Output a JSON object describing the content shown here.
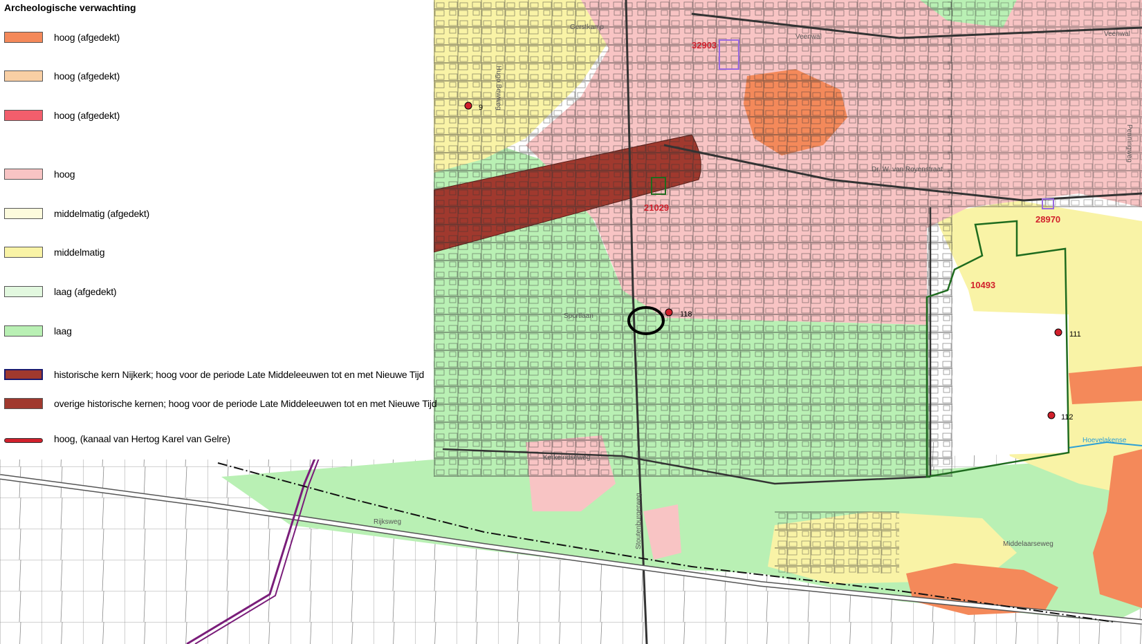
{
  "legend": {
    "title": "Archeologische  verwachting",
    "items": [
      {
        "label": "hoog (afgedekt)",
        "color": "#f4895a",
        "kind": "box"
      },
      {
        "label": "hoog (afgedekt)",
        "color": "#f9cfa4",
        "kind": "box"
      },
      {
        "label": "hoog (afgedekt)",
        "color": "#f25e6c",
        "kind": "box"
      },
      {
        "label": "hoog",
        "color": "#f8c4c4",
        "kind": "box"
      },
      {
        "label": "middelmatig (afgedekt)",
        "color": "#fdfbdd",
        "kind": "box"
      },
      {
        "label": "middelmatig",
        "color": "#f9f3a6",
        "kind": "box"
      },
      {
        "label": "laag (afgedekt)",
        "color": "#e2f8df",
        "kind": "box"
      },
      {
        "label": "laag",
        "color": "#b9f0b4",
        "kind": "box"
      },
      {
        "label": "historische kern Nijkerk; hoog voor de periode Late Middeleeuwen tot en met Nieuwe Tijd",
        "color": "#a0392e",
        "kind": "box-thick"
      },
      {
        "label": "overige historische kernen; hoog voor de periode Late Middeleeuwen tot en met Nieuwe Tijd",
        "color": "#a0392e",
        "kind": "box"
      },
      {
        "label": "hoog, (kanaal van Hertog Karel van Gelre)",
        "color": "#d1202c",
        "kind": "line"
      }
    ]
  },
  "map": {
    "site_labels": [
      "32903",
      "21029",
      "28970",
      "10493"
    ],
    "point_labels": [
      "9",
      "118",
      "111",
      "112"
    ],
    "street_labels": [
      "Gerstkamp",
      "Veenwal",
      "Veenwal",
      "Hugo Bewweg",
      "Dr. W. van Royenstraat",
      "Penningweg",
      "Sportlaan",
      "Kerkeindseweg",
      "Rijksweg",
      "Stoutenburgerweg",
      "Middelaarseweg",
      "Hoevelakense"
    ],
    "colors": {
      "high": "#f8c4c4",
      "medium": "#f9f3a6",
      "low": "#b9f0b4",
      "high_covered": "#f4895a",
      "historic_core": "#a0392e",
      "site_label": "#d1202c",
      "railway": "#7a1d7a",
      "water": "#2a9fd6"
    }
  }
}
